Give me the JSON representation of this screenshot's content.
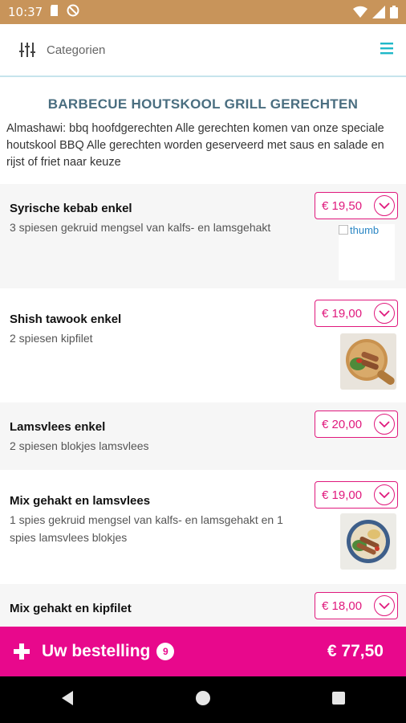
{
  "status_bar": {
    "time": "10:37"
  },
  "top_bar": {
    "categories_label": "Categorien"
  },
  "section": {
    "title": "BARBECUE HOUTSKOOL GRILL GERECHTEN",
    "description": "Almashawi: bbq hoofdgerechten Alle gerechten komen van onze speciale houtskool BBQ Alle gerechten worden geserveerd met saus en salade en rijst of friet naar keuze"
  },
  "items": [
    {
      "name": "Syrische kebab enkel",
      "desc": "3 spiesen gekruid mengsel van kalfs- en lamsgehakt",
      "price": "€ 19,50",
      "image_alt": "thumb"
    },
    {
      "name": "Shish tawook enkel",
      "desc": "2 spiesen kipfilet",
      "price": "€ 19,00"
    },
    {
      "name": "Lamsvlees enkel",
      "desc": "2 spiesen blokjes lamsvlees",
      "price": "€ 20,00"
    },
    {
      "name": "Mix gehakt en lamsvlees",
      "desc": "1 spies gekruid mengsel van kalfs- en lamsgehakt en 1 spies lamsvlees blokjes",
      "price": "€ 19,00"
    },
    {
      "name": "Mix gehakt en kipfilet",
      "desc": "",
      "price": "€ 18,00"
    }
  ],
  "order_bar": {
    "label": "Uw bestelling",
    "count": "9",
    "total": "€ 77,50"
  },
  "colors": {
    "accent": "#e8088c",
    "price": "#e0197d",
    "title": "#4a6e80",
    "status_bar": "#c8945a",
    "menu_icon": "#1fb8c8"
  }
}
